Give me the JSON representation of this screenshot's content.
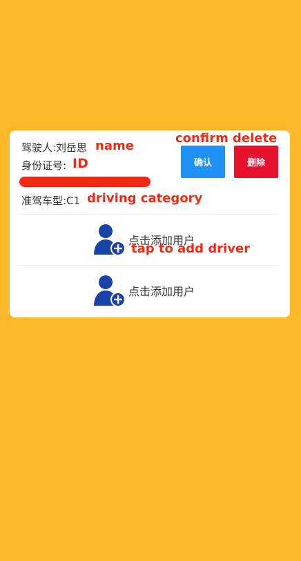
{
  "driver": {
    "name_label": "驾驶人:刘岳思",
    "id_label": "身份证号:",
    "category_label": "准驾车型:C1"
  },
  "buttons": {
    "confirm_label": "确认",
    "delete_label": "删除"
  },
  "add_user": {
    "label": "点击添加用户"
  },
  "annotations": {
    "name": "name",
    "id": "ID",
    "confirm": "confirm",
    "delete": "delete",
    "driving_category": "driving category",
    "tap_to_add": "tap to add driver"
  },
  "colors": {
    "background": "#FDB92A",
    "card": "#FFFFFF",
    "confirm_button": "#1E93F5",
    "delete_button": "#E8112D",
    "annotation_red": "#F02A15",
    "user_icon": "#1843A8"
  },
  "icons": {
    "add_user": "add-user-icon"
  }
}
